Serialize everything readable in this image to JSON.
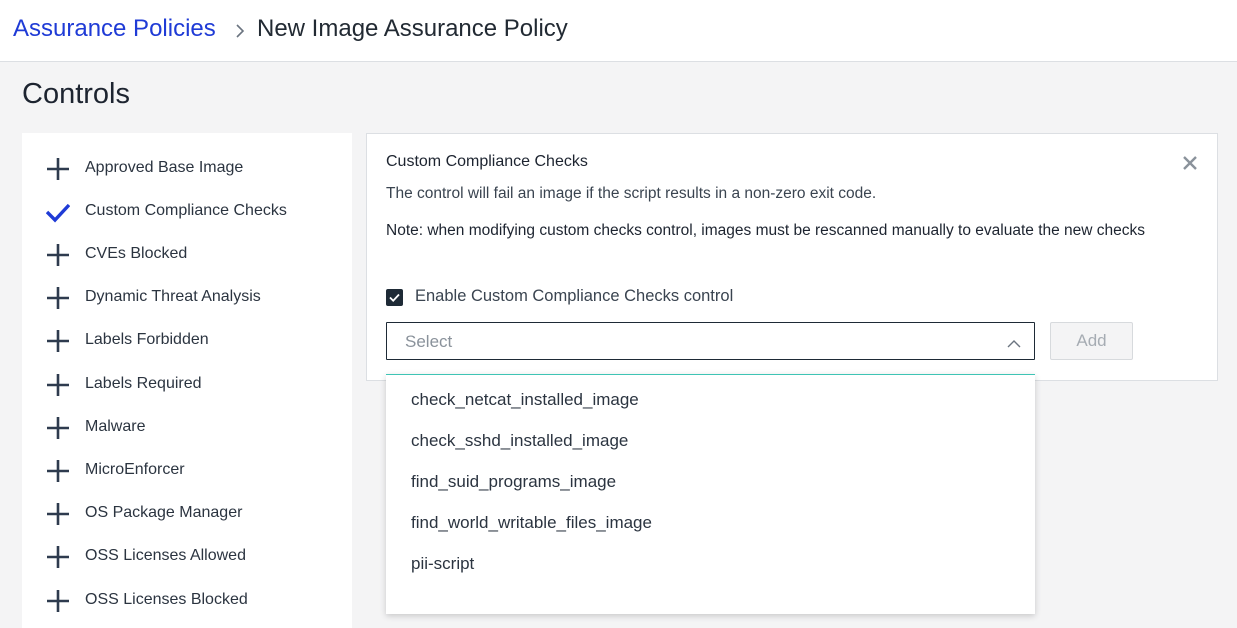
{
  "breadcrumb": {
    "parent": "Assurance Policies",
    "current": "New Image Assurance Policy",
    "separator_icon": "chevron-right-icon"
  },
  "page_title": "Controls",
  "sidebar": {
    "items": [
      {
        "label": "Approved Base Image",
        "icon": "plus-icon",
        "selected": false
      },
      {
        "label": "Custom Compliance Checks",
        "icon": "check-icon",
        "selected": true
      },
      {
        "label": "CVEs Blocked",
        "icon": "plus-icon",
        "selected": false
      },
      {
        "label": "Dynamic Threat Analysis",
        "icon": "plus-icon",
        "selected": false
      },
      {
        "label": "Labels Forbidden",
        "icon": "plus-icon",
        "selected": false
      },
      {
        "label": "Labels Required",
        "icon": "plus-icon",
        "selected": false
      },
      {
        "label": "Malware",
        "icon": "plus-icon",
        "selected": false
      },
      {
        "label": "MicroEnforcer",
        "icon": "plus-icon",
        "selected": false
      },
      {
        "label": "OS Package Manager",
        "icon": "plus-icon",
        "selected": false
      },
      {
        "label": "OSS Licenses Allowed",
        "icon": "plus-icon",
        "selected": false
      },
      {
        "label": "OSS Licenses Blocked",
        "icon": "plus-icon",
        "selected": false
      }
    ]
  },
  "panel": {
    "title": "Custom Compliance Checks",
    "description": "The control will fail an image if the script results in a non-zero exit code.",
    "note": "Note: when modifying custom checks control, images must be rescanned manually to evaluate the new checks",
    "enable_label": "Enable Custom Compliance Checks control",
    "enable_checked": true,
    "select_placeholder": "Select",
    "add_label": "Add",
    "close_icon": "close-icon"
  },
  "dropdown": {
    "options": [
      "check_netcat_installed_image",
      "check_sshd_installed_image",
      "find_suid_programs_image",
      "find_world_writable_files_image",
      "pii-script"
    ]
  },
  "colors": {
    "link": "#1f3bd6",
    "check_icon": "#1f3bd6",
    "plus_icon": "#2e3b4e",
    "dropdown_accent": "#3fc4b5",
    "checkbox_fill": "#1e2a36"
  }
}
